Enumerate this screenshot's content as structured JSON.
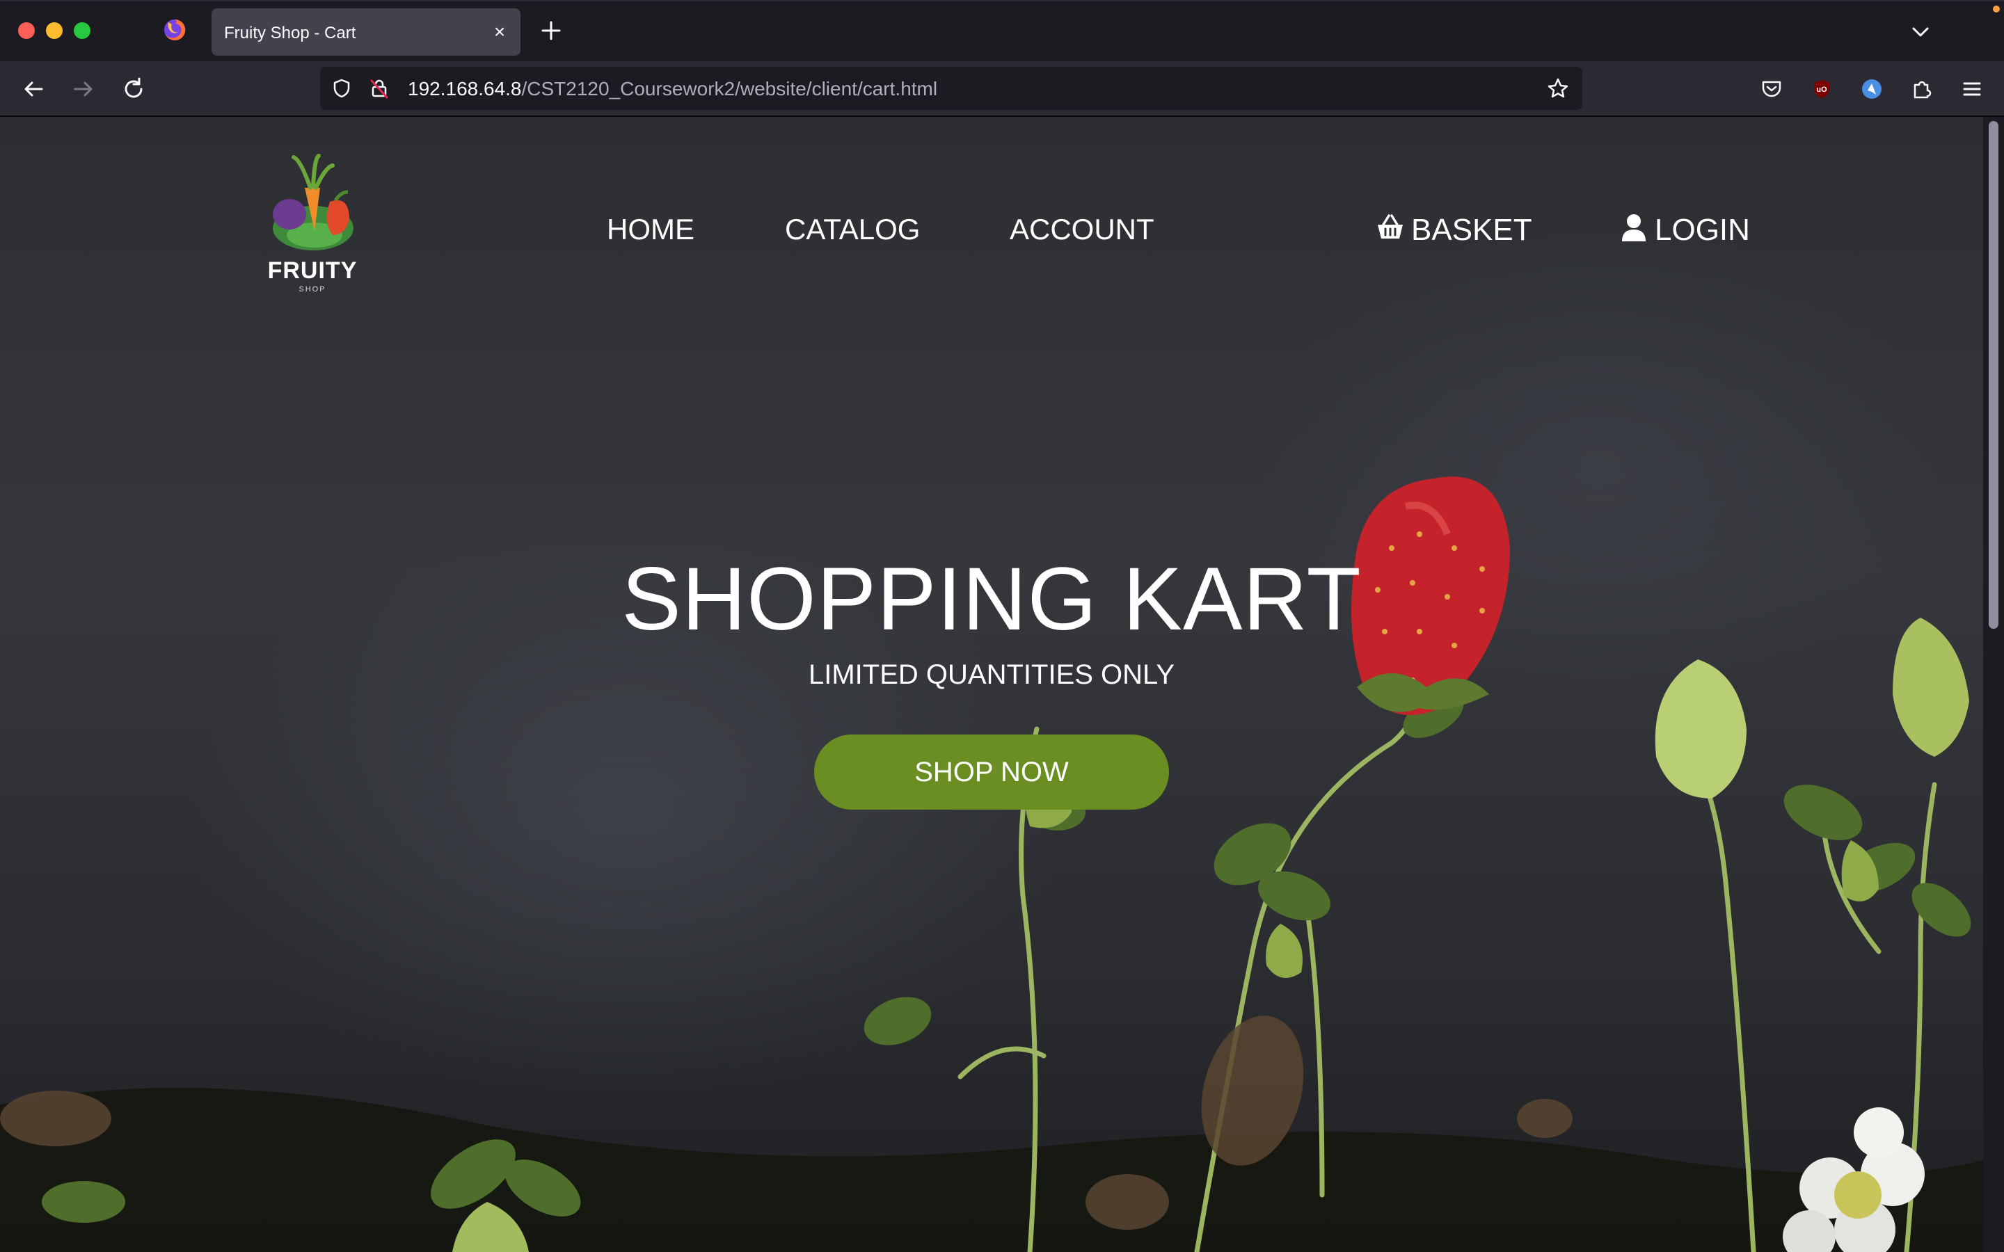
{
  "browser": {
    "tab_title": "Fruity Shop - Cart",
    "tab_close": "×",
    "url_host": "192.168.64.8",
    "url_path": "/CST2120_Coursework2/website/client/cart.html"
  },
  "site": {
    "logo_word": "FRUITY",
    "logo_sub": "SHOP",
    "nav": {
      "home": "HOME",
      "catalog": "CATALOG",
      "account": "ACCOUNT",
      "basket": "BASKET",
      "login": "LOGIN"
    },
    "hero": {
      "title": "SHOPPING KART",
      "subtitle": "LIMITED QUANTITIES ONLY",
      "cta": "SHOP NOW"
    }
  },
  "colors": {
    "cta": "#6b8e23",
    "chrome_dark": "#1c1b22",
    "chrome_toolbar": "#2b2a33"
  },
  "icons": [
    "firefox-icon",
    "new-tab-icon",
    "tab-list-icon",
    "back-icon",
    "forward-icon",
    "reload-icon",
    "shield-icon",
    "lock-slash-icon",
    "star-icon",
    "pocket-icon",
    "ublock-icon",
    "extension-icon",
    "puzzle-icon",
    "menu-icon",
    "basket-icon",
    "user-icon"
  ]
}
